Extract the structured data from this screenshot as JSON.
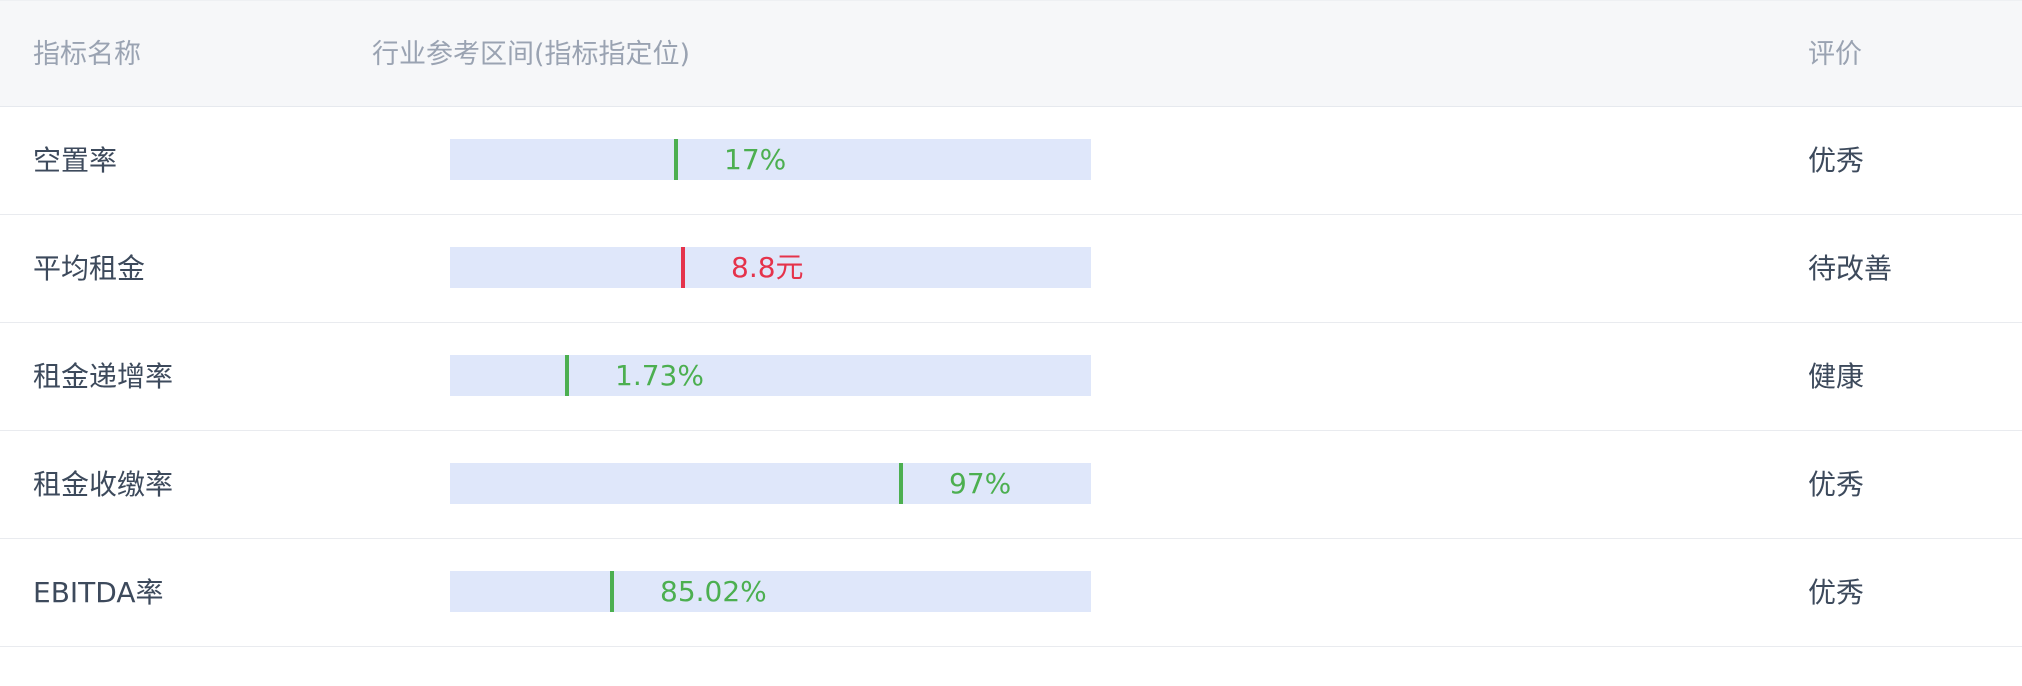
{
  "header": {
    "name": "指标名称",
    "range": "行业参考区间(指标指定位)",
    "evaluation": "评价"
  },
  "colors": {
    "good": "#4caf50",
    "bad": "#e5334b",
    "bar_bg": "#dfe7fa"
  },
  "rows": [
    {
      "name": "空置率",
      "value": "17%",
      "position": 0.35,
      "status": "good",
      "evaluation": "优秀"
    },
    {
      "name": "平均租金",
      "value": "8.8元",
      "position": 0.36,
      "status": "bad",
      "evaluation": "待改善"
    },
    {
      "name": "租金递增率",
      "value": "1.73%",
      "position": 0.18,
      "status": "good",
      "evaluation": "健康"
    },
    {
      "name": "租金收缴率",
      "value": "97%",
      "position": 0.7,
      "status": "good",
      "evaluation": "优秀"
    },
    {
      "name": "EBITDA率",
      "value": "85.02%",
      "position": 0.25,
      "status": "good",
      "evaluation": "优秀"
    }
  ]
}
